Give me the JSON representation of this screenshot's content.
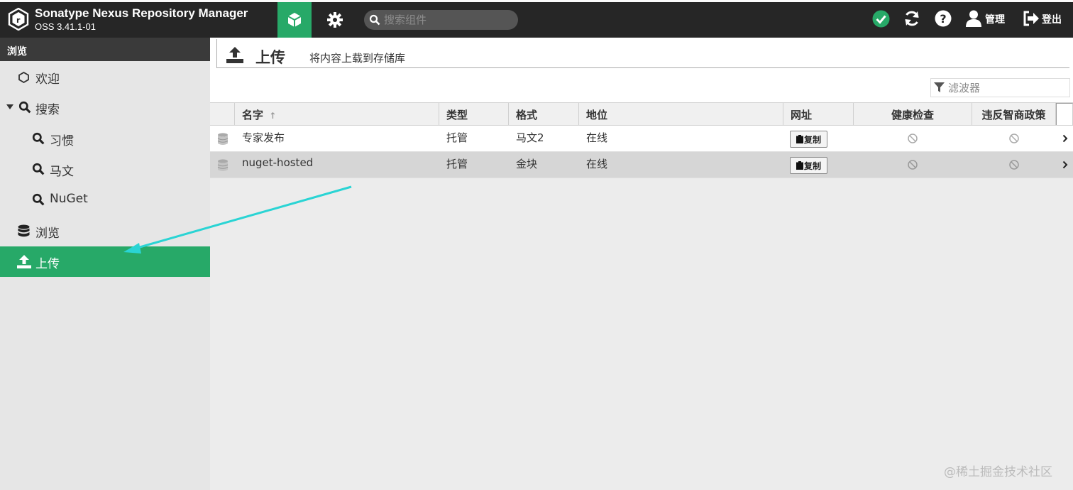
{
  "header": {
    "brand_title": "Sonatype Nexus Repository Manager",
    "brand_version": "OSS 3.41.1-01",
    "search_placeholder": "搜索组件",
    "admin_label": "管理",
    "logout_label": "登出"
  },
  "sidebar": {
    "header": "浏览",
    "items": [
      {
        "label": "欢迎"
      },
      {
        "label": "搜索"
      },
      {
        "label": "习惯"
      },
      {
        "label": "马文"
      },
      {
        "label": "NuGet"
      },
      {
        "label": "浏览"
      },
      {
        "label": "上传"
      }
    ]
  },
  "page": {
    "title": "上传",
    "description": "将内容上载到存储库",
    "filter_placeholder": "滤波器"
  },
  "table": {
    "columns": [
      "名字",
      "类型",
      "格式",
      "地位",
      "网址",
      "健康检查",
      "违反智商政策"
    ],
    "copy_label": "复制",
    "rows": [
      {
        "name": "专家发布",
        "type": "托管",
        "format": "马文2",
        "status": "在线"
      },
      {
        "name": "nuget-hosted",
        "type": "托管",
        "format": "金块",
        "status": "在线"
      }
    ]
  },
  "watermark": "@稀土掘金技术社区",
  "colors": {
    "accent": "#27a968",
    "topbar": "#262626",
    "annotation_arrow": "#2ad4d4"
  }
}
